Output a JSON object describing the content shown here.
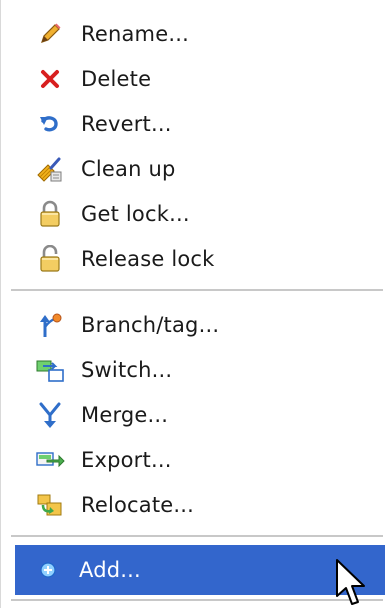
{
  "menu": {
    "items": [
      {
        "label": "Rename...",
        "icon": "pencil-icon"
      },
      {
        "label": "Delete",
        "icon": "red-x-icon"
      },
      {
        "label": "Revert...",
        "icon": "undo-arrow-icon"
      },
      {
        "label": "Clean up",
        "icon": "broom-icon"
      },
      {
        "label": "Get lock...",
        "icon": "closed-lock-icon"
      },
      {
        "label": "Release lock",
        "icon": "open-lock-icon"
      },
      {
        "label": "Branch/tag...",
        "icon": "branch-icon"
      },
      {
        "label": "Switch...",
        "icon": "switch-icon"
      },
      {
        "label": "Merge...",
        "icon": "merge-icon"
      },
      {
        "label": "Export...",
        "icon": "export-icon"
      },
      {
        "label": "Relocate...",
        "icon": "relocate-icon"
      },
      {
        "label": "Add...",
        "icon": "add-plus-icon"
      }
    ]
  },
  "colors": {
    "highlight": "#3366cc",
    "delete_red": "#d81f1f",
    "icon_blue": "#2f6ec9"
  }
}
